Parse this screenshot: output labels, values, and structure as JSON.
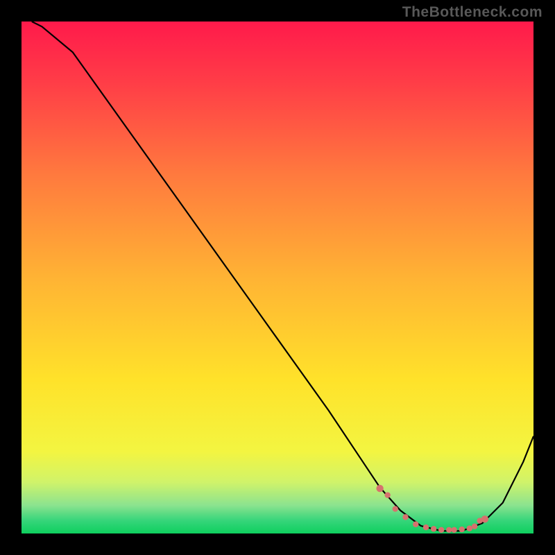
{
  "watermark": "TheBottleneck.com",
  "chart_data": {
    "type": "line",
    "title": "",
    "xlabel": "",
    "ylabel": "",
    "xlim": [
      0,
      100
    ],
    "ylim": [
      0,
      100
    ],
    "series": [
      {
        "name": "curve",
        "color": "#000000",
        "x": [
          2,
          4,
          10,
          20,
          30,
          40,
          50,
          60,
          66,
          70,
          74,
          78,
          82,
          86,
          90,
          94,
          98,
          100
        ],
        "y": [
          100,
          99,
          94,
          80,
          66,
          52,
          38,
          24,
          15,
          9,
          4.5,
          1.5,
          0.5,
          0.5,
          2,
          6,
          14,
          19
        ]
      },
      {
        "name": "markers",
        "color": "#d6726e",
        "type": "scatter",
        "x": [
          70,
          71.5,
          73,
          75,
          77,
          79,
          80.5,
          82,
          83.5,
          84.5,
          86,
          87.5,
          88.5,
          89.5,
          90.5
        ],
        "y": [
          8.8,
          7.5,
          4.8,
          3.2,
          1.8,
          1.2,
          0.9,
          0.7,
          0.7,
          0.7,
          0.8,
          1.0,
          1.4,
          2.5,
          2.8
        ]
      }
    ],
    "background_gradient": {
      "stops": [
        {
          "offset": 0.0,
          "color": "#ff1a4b"
        },
        {
          "offset": 0.12,
          "color": "#ff3d47"
        },
        {
          "offset": 0.3,
          "color": "#ff7a3e"
        },
        {
          "offset": 0.5,
          "color": "#ffb334"
        },
        {
          "offset": 0.7,
          "color": "#ffe22a"
        },
        {
          "offset": 0.84,
          "color": "#f3f541"
        },
        {
          "offset": 0.9,
          "color": "#d0f36a"
        },
        {
          "offset": 0.945,
          "color": "#8be38f"
        },
        {
          "offset": 0.975,
          "color": "#35d57a"
        },
        {
          "offset": 1.0,
          "color": "#0ecf5e"
        }
      ]
    }
  }
}
